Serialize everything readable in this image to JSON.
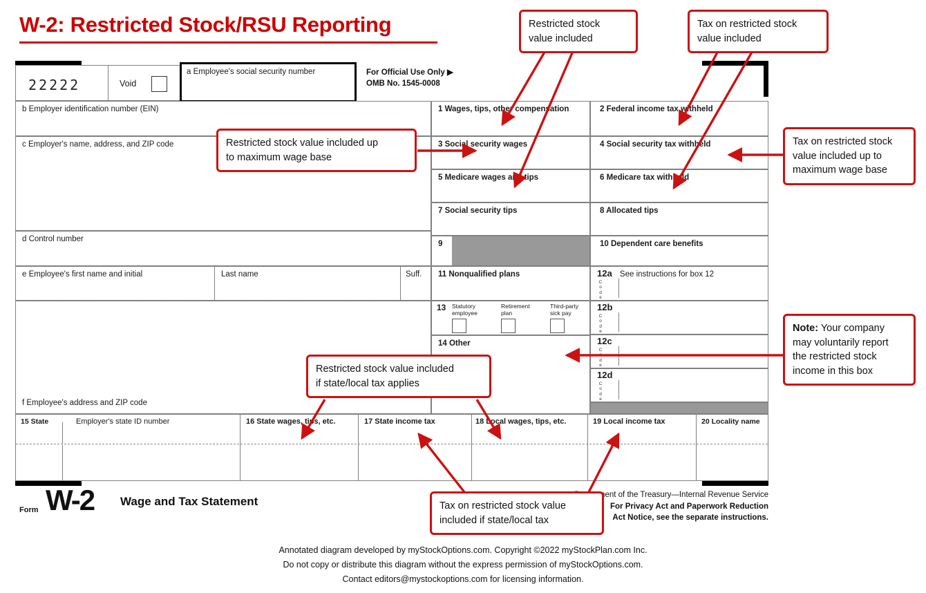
{
  "title": "W-2: Restricted Stock/RSU Reporting",
  "form": {
    "control_number_value": "22222",
    "void_label": "Void",
    "box_a": "a  Employee's social security number",
    "official_use_line1": "For Official Use Only ▶",
    "official_use_line2": "OMB No. 1545-0008",
    "box_b": "b  Employer identification number (EIN)",
    "box_c": "c  Employer's name, address, and ZIP code",
    "box_d": "d  Control number",
    "box_e": "e  Employee's first name and initial",
    "box_e_last": "Last name",
    "box_e_suff": "Suff.",
    "box_f": "f  Employee's address and ZIP code",
    "box_1": "1   Wages, tips, other compensation",
    "box_2": "2   Federal income tax withheld",
    "box_3": "3   Social security wages",
    "box_4": "4   Social security tax withheld",
    "box_5": "5   Medicare wages and tips",
    "box_6": "6   Medicare tax withheld",
    "box_7": "7   Social security tips",
    "box_8": "8   Allocated tips",
    "box_9": "9",
    "box_10": "10   Dependent care benefits",
    "box_11": "11   Nonqualified plans",
    "box_12a": "12a",
    "box_12a_text": "See instructions for box 12",
    "box_12b": "12b",
    "box_12c": "12c",
    "box_12d": "12d",
    "code_label": "Code",
    "box_13": "13",
    "box_13_cb1": "Statutory\nemployee",
    "box_13_cb2": "Retirement\nplan",
    "box_13_cb3": "Third-party\nsick pay",
    "box_14": "14   Other",
    "box_15_state": "15  State",
    "box_15_id": "Employer's state ID number",
    "box_16": "16  State wages, tips, etc.",
    "box_17": "17  State income tax",
    "box_18": "18  Local wages, tips, etc.",
    "box_19": "19  Local income tax",
    "box_20": "20  Locality name",
    "footer_form_word": "Form",
    "footer_w2": "W-2",
    "footer_title": "Wage and Tax Statement",
    "dept_line1": "Department of the Treasury—Internal Revenue Service",
    "dept_line2": "For Privacy Act and Paperwork Reduction",
    "dept_line3": "Act Notice, see the separate instructions."
  },
  "callouts": {
    "c1": "Restricted stock\nvalue included",
    "c2": "Tax on restricted stock\nvalue included",
    "c3": "Restricted stock value included up\nto maximum wage base",
    "c4": "Tax on restricted stock\nvalue included up to\nmaximum wage base",
    "c5_bold": "Note:",
    "c5_rest": " Your company\nmay voluntarily report\nthe restricted stock\nincome in this box",
    "c6": "Restricted stock value included\nif state/local tax applies",
    "c7": "Tax on restricted stock value\nincluded if state/local tax"
  },
  "credits": {
    "line1": "Annotated diagram developed by myStockOptions.com. Copyright ©2022 myStockPlan.com Inc.",
    "line2": "Do not copy or distribute this diagram without the express permission of myStockOptions.com.",
    "line3": "Contact editors@mystockoptions.com for licensing information."
  },
  "colors": {
    "accent_red": "#cc1111",
    "title_red": "#cc0000",
    "grid_gray": "#808080",
    "shaded_gray": "#999999"
  }
}
